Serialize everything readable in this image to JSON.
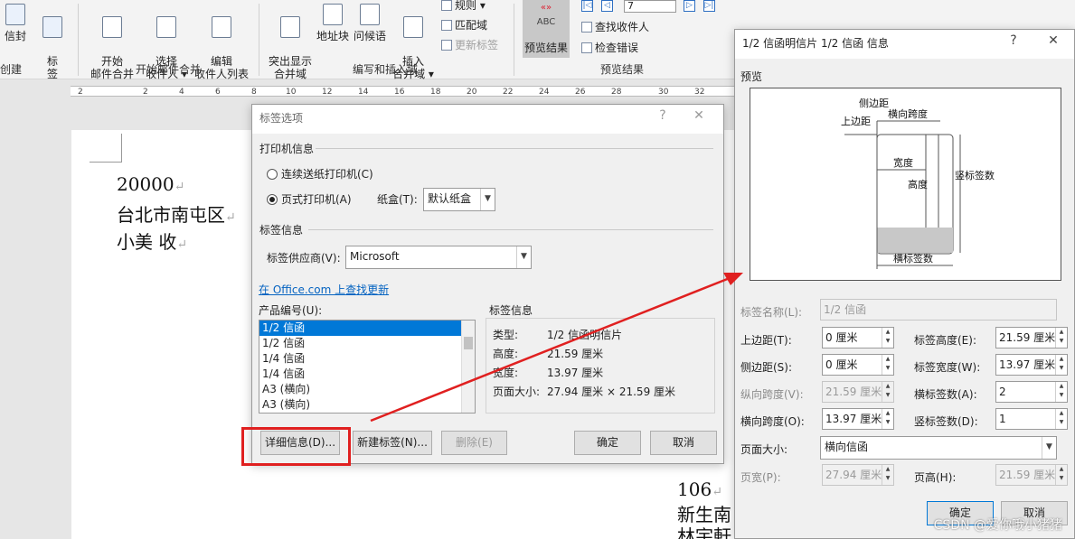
{
  "ribbon": {
    "buttons": {
      "envelope": "信封",
      "labels": "标\n签",
      "start_merge": "开始\n邮件合并 ▾",
      "select_recipients": "选择\n收件人 ▾",
      "edit_recipients": "编辑\n收件人列表",
      "highlight_fields": "突出显示\n合并域",
      "address_block": "地址块",
      "greeting": "问候语",
      "insert_field": "插入\n合并域 ▾",
      "preview_results": "预览结果",
      "preview_abc": "ABC",
      "preview_chev": "«»"
    },
    "mini": {
      "rules": "规则 ▾",
      "match_fields": "匹配域",
      "update_labels": "更新标签",
      "find_recipient": "查找收件人",
      "check_errors": "检查错误"
    },
    "record_value": "7",
    "groups": {
      "create": "创建",
      "start_merge": "开始邮件合并",
      "write_insert": "编写和插入域",
      "preview": "预览结果"
    }
  },
  "ruler": {
    "ticks": [
      "2",
      "2",
      "4",
      "6",
      "8",
      "10",
      "12",
      "14",
      "16",
      "18",
      "20",
      "22",
      "24",
      "26",
      "28",
      "30",
      "32"
    ]
  },
  "document": {
    "zip": "20000",
    "address": "台北市南屯区",
    "recipient": "小美 收",
    "zip2": "106",
    "address2": "新生南",
    "recipient2": "林宇軒",
    "para_mark": "↵",
    "corner_mark": "⌐"
  },
  "label_options": {
    "title": "标签选项",
    "help": "?",
    "close": "✕",
    "printer_info": "打印机信息",
    "continuous": "连续送纸打印机(C)",
    "page_printer": "页式打印机(A)",
    "tray_label": "纸盒(T):",
    "tray_value": "默认纸盒",
    "label_info": "标签信息",
    "vendor_label": "标签供应商(V):",
    "vendor_value": "Microsoft",
    "office_link": "在 Office.com 上查找更新",
    "product_label": "产品编号(U):",
    "products": [
      "1/2 信函",
      "1/2 信函",
      "1/4 信函",
      "1/4 信函",
      "A3 (横向)",
      "A3 (横向)"
    ],
    "selected_index": 0,
    "details_title": "标签信息",
    "type_label": "类型:",
    "type_value": "1/2 信函明信片",
    "height_label": "高度:",
    "height_value": "21.59 厘米",
    "width_label": "宽度:",
    "width_value": "13.97 厘米",
    "pagesize_label": "页面大小:",
    "pagesize_value": "27.94 厘米 × 21.59 厘米",
    "details_btn": "详细信息(D)...",
    "new_label_btn": "新建标签(N)...",
    "delete_btn": "删除(E)",
    "ok_btn": "确定",
    "cancel_btn": "取消"
  },
  "details": {
    "title": "1/2 信函明信片 1/2 信函 信息",
    "help": "?",
    "close": "✕",
    "preview_label": "预览",
    "pv": {
      "side_margin": "侧边距",
      "top_margin": "上边距",
      "h_pitch": "横向跨度",
      "width": "宽度",
      "height": "高度",
      "v_count": "竖标签数",
      "h_count": "横标签数"
    },
    "name_label": "标签名称(L):",
    "name_value": "1/2 信函",
    "top_margin_label": "上边距(T):",
    "top_margin_value": "0 厘米",
    "side_margin_label": "侧边距(S):",
    "side_margin_value": "0 厘米",
    "v_pitch_label": "纵向跨度(V):",
    "v_pitch_value": "21.59 厘米",
    "h_pitch_label": "横向跨度(O):",
    "h_pitch_value": "13.97 厘米",
    "label_height_label": "标签高度(E):",
    "label_height_value": "21.59 厘米",
    "label_width_label": "标签宽度(W):",
    "label_width_value": "13.97 厘米",
    "across_label": "横标签数(A):",
    "across_value": "2",
    "down_label": "竖标签数(D):",
    "down_value": "1",
    "page_size_label": "页面大小:",
    "page_size_value": "横向信函",
    "page_width_label": "页宽(P):",
    "page_width_value": "27.94 厘米",
    "page_height_label": "页高(H):",
    "page_height_value": "21.59 厘米",
    "ok_btn": "确定",
    "cancel_btn": "取消"
  },
  "watermark": "CSDN @爱你哦小猪猪",
  "colors": {
    "accent": "#0078d7",
    "highlight": "#e02020",
    "link": "#0563c1"
  }
}
